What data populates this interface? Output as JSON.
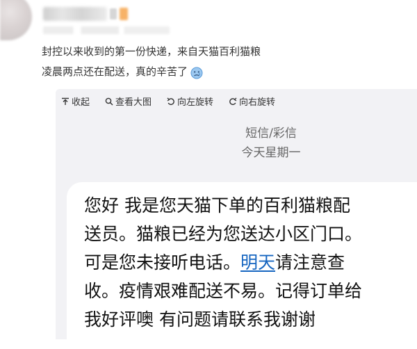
{
  "post": {
    "line1": "封控以来收到的第一份快递，来自天猫百利猫粮",
    "line2": "凌晨两点还在配送，真的辛苦了"
  },
  "toolbar": {
    "collapse_label": "收起",
    "view_large_label": "查看大图",
    "rotate_left_label": "向左旋转",
    "rotate_right_label": "向右旋转"
  },
  "sms": {
    "header_type": "短信/彩信",
    "header_date": "今天星期一",
    "line1": "您好 我是您天猫下单的百利猫粮配",
    "line2": "送员。猫粮已经为您送达小区门口。",
    "line3_before": "可是您未接听电话。",
    "line3_link": "明天",
    "line3_after": "请注意查",
    "line4": "收。疫情艰难配送不易。记得订单给",
    "line5": "我好评噢 有问题请联系我谢谢"
  },
  "colors": {
    "link": "#1565c0",
    "media_bg": "#f2f2f5",
    "badge": "#f7b267"
  },
  "icons": [
    "collapse-up-icon",
    "magnifier-icon",
    "rotate-left-icon",
    "rotate-right-icon",
    "sad-face-emoji-icon"
  ]
}
